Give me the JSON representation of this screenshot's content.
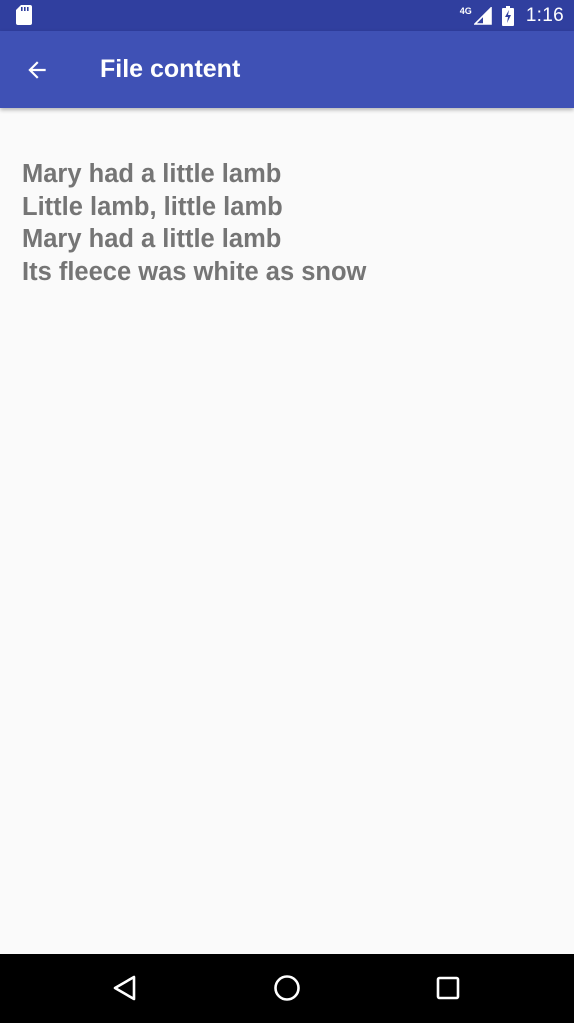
{
  "status_bar": {
    "network_label": "4G",
    "time": "1:16",
    "icons": [
      "sd-card-icon",
      "signal-icon",
      "battery-charging-icon"
    ]
  },
  "app_bar": {
    "title": "File content",
    "back_icon": "arrow-back-icon"
  },
  "file": {
    "lines": [
      "Mary had a little lamb",
      "Little lamb, little lamb",
      "Mary had a little lamb",
      "Its fleece was white as snow"
    ]
  },
  "nav_bar": {
    "icons": [
      "nav-back-icon",
      "nav-home-icon",
      "nav-recents-icon"
    ]
  },
  "colors": {
    "status_bar": "#303f9f",
    "app_bar": "#3f51b5",
    "background": "#fafafa",
    "text": "#757575",
    "nav_bar": "#000000"
  }
}
